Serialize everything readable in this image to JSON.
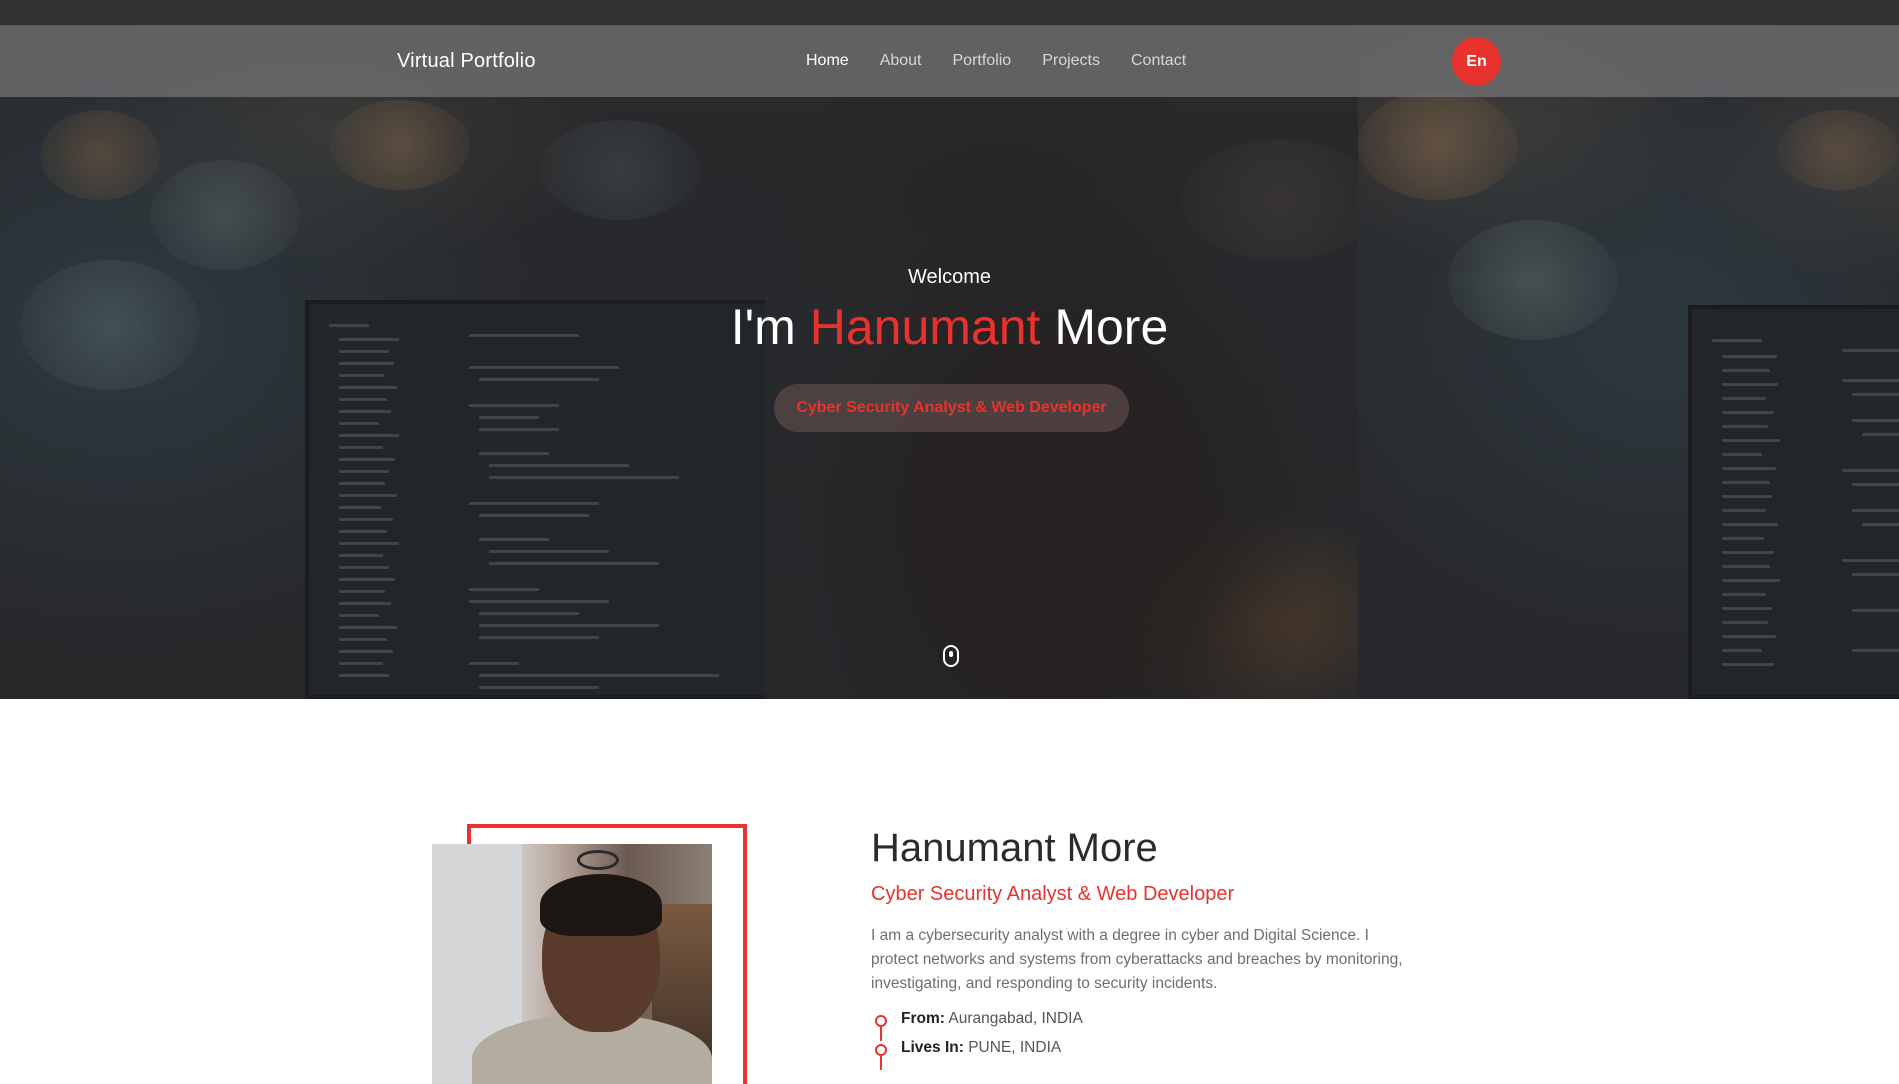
{
  "brand": "Virtual Portfolio",
  "nav": {
    "items": [
      "Home",
      "About",
      "Portfolio",
      "Projects",
      "Contact"
    ],
    "active": "Home",
    "lang_button": "En"
  },
  "hero": {
    "welcome": "Welcome",
    "name_prefix": "I'm",
    "name_accent": "Hanumant",
    "name_suffix": "More",
    "role": "Cyber Security Analyst & Web Developer",
    "scroll_icon": "mouse-icon"
  },
  "about": {
    "name": "Hanumant More",
    "role": "Cyber Security Analyst & Web Developer",
    "bio": "I am a cybersecurity analyst with a degree in cyber and Digital Science. I protect networks and systems from cyberattacks and breaches by monitoring, investigating, and responding to security incidents.",
    "facts": [
      {
        "label": "From:",
        "value": "Aurangabad, INDIA"
      },
      {
        "label": "Lives In:",
        "value": "PUNE, INDIA"
      }
    ]
  },
  "colors": {
    "accent": "#e8322d",
    "navbar": "#6e6e70",
    "hero_bg": "#2f2f30"
  }
}
